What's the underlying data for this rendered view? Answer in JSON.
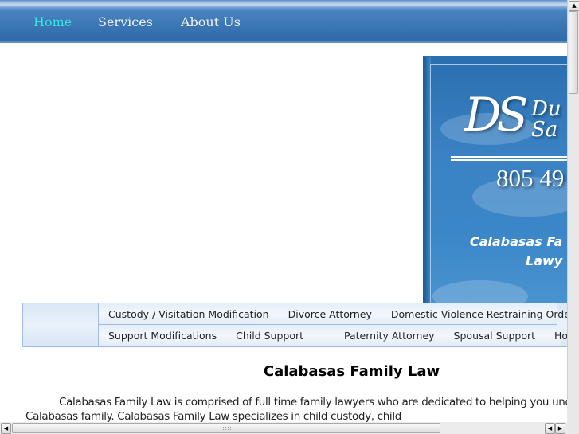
{
  "topnav": {
    "items": [
      {
        "label": "Home",
        "active": true
      },
      {
        "label": "Services",
        "active": false
      },
      {
        "label": "About Us",
        "active": false
      }
    ],
    "active_color": "#38e6e6"
  },
  "banner": {
    "logo_initials": "DS",
    "logo_name_line1": "Du",
    "logo_name_line2": "Sa",
    "phone": "805 49",
    "tagline_line1": "Calabasas Fa",
    "tagline_line2": "Lawy"
  },
  "subnav": {
    "row1": [
      "Custody / Visitation Modification",
      "Divorce Attorney",
      "Domestic Violence Restraining Orders"
    ],
    "row2": [
      "Support Modifications",
      "Child Support",
      "Paternity Attorney",
      "Spousal Support",
      "Home"
    ]
  },
  "content": {
    "title": "Calabasas Family Law",
    "body": "Calabasas Family Law is comprised of full time family lawyers who are dedicated to helping you understand a appropriate to protect your and your Calabasas family. Calabasas Family Law specializes in child custody, child"
  },
  "scrollbars": {
    "up_arrow": "▲",
    "down_arrow": "▼",
    "left_arrow": "◀",
    "right_arrow": "▶"
  }
}
